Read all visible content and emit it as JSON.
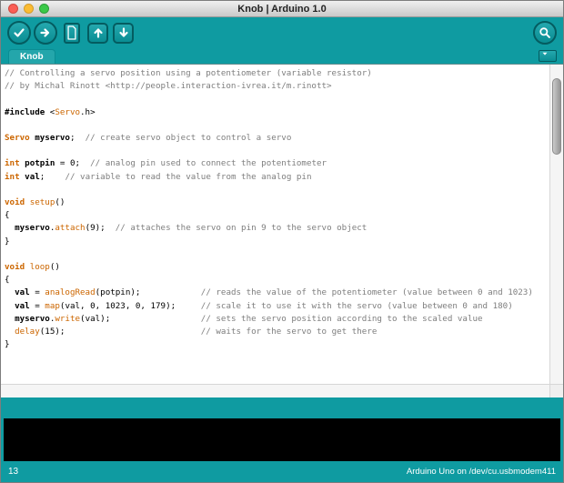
{
  "window": {
    "title": "Knob | Arduino 1.0"
  },
  "toolbar": {
    "left_buttons": [
      {
        "name": "verify",
        "icon": "check-icon",
        "shape": "circle"
      },
      {
        "name": "upload",
        "icon": "arrow-right-icon",
        "shape": "circle"
      },
      {
        "name": "new-sketch",
        "icon": "document-icon",
        "shape": "page"
      },
      {
        "name": "open",
        "icon": "arrow-up-icon",
        "shape": "square"
      },
      {
        "name": "save",
        "icon": "arrow-down-icon",
        "shape": "square"
      }
    ],
    "right_buttons": [
      {
        "name": "serial-monitor",
        "icon": "magnifier-icon",
        "shape": "circle"
      }
    ]
  },
  "tab_bar": {
    "tabs": [
      {
        "label": "Knob",
        "active": true
      }
    ],
    "menu_icon": "chevron-down-icon"
  },
  "editor": {
    "lines": [
      [
        [
          "c",
          "// Controlling a servo position using a potentiometer (variable resistor)"
        ]
      ],
      [
        [
          "c",
          "// by Michal Rinott <http://people.interaction-ivrea.it/m.rinott>"
        ]
      ],
      [],
      [
        [
          "b",
          "#include"
        ],
        [
          "p",
          " <"
        ],
        [
          "f",
          "Servo"
        ],
        [
          "p",
          ".h>"
        ]
      ],
      [],
      [
        [
          "k",
          "Servo"
        ],
        [
          "p",
          " "
        ],
        [
          "b",
          "myservo"
        ],
        [
          "p",
          ";  "
        ],
        [
          "c",
          "// create servo object to control a servo"
        ]
      ],
      [],
      [
        [
          "k",
          "int"
        ],
        [
          "p",
          " "
        ],
        [
          "b",
          "potpin"
        ],
        [
          "p",
          " = 0;  "
        ],
        [
          "c",
          "// analog pin used to connect the potentiometer"
        ]
      ],
      [
        [
          "k",
          "int"
        ],
        [
          "p",
          " "
        ],
        [
          "b",
          "val"
        ],
        [
          "p",
          ";    "
        ],
        [
          "c",
          "// variable to read the value from the analog pin"
        ]
      ],
      [],
      [
        [
          "k",
          "void"
        ],
        [
          "p",
          " "
        ],
        [
          "f",
          "setup"
        ],
        [
          "p",
          "()"
        ]
      ],
      [
        [
          "p",
          "{"
        ]
      ],
      [
        [
          "p",
          "  "
        ],
        [
          "b",
          "myservo"
        ],
        [
          "p",
          "."
        ],
        [
          "f",
          "attach"
        ],
        [
          "p",
          "(9);  "
        ],
        [
          "c",
          "// attaches the servo on pin 9 to the servo object"
        ]
      ],
      [
        [
          "p",
          "}"
        ]
      ],
      [],
      [
        [
          "k",
          "void"
        ],
        [
          "p",
          " "
        ],
        [
          "f",
          "loop"
        ],
        [
          "p",
          "()"
        ]
      ],
      [
        [
          "p",
          "{"
        ]
      ],
      [
        [
          "p",
          "  "
        ],
        [
          "b",
          "val"
        ],
        [
          "p",
          " = "
        ],
        [
          "f",
          "analogRead"
        ],
        [
          "p",
          "(potpin);            "
        ],
        [
          "c",
          "// reads the value of the potentiometer (value between 0 and 1023)"
        ]
      ],
      [
        [
          "p",
          "  "
        ],
        [
          "b",
          "val"
        ],
        [
          "p",
          " = "
        ],
        [
          "f",
          "map"
        ],
        [
          "p",
          "(val, 0, 1023, 0, 179);     "
        ],
        [
          "c",
          "// scale it to use it with the servo (value between 0 and 180)"
        ]
      ],
      [
        [
          "p",
          "  "
        ],
        [
          "b",
          "myservo"
        ],
        [
          "p",
          "."
        ],
        [
          "f",
          "write"
        ],
        [
          "p",
          "(val);                  "
        ],
        [
          "c",
          "// sets the servo position according to the scaled value"
        ]
      ],
      [
        [
          "p",
          "  "
        ],
        [
          "f",
          "delay"
        ],
        [
          "p",
          "(15);                           "
        ],
        [
          "c",
          "// waits for the servo to get there"
        ]
      ],
      [
        [
          "p",
          "}"
        ]
      ]
    ]
  },
  "status_bar": {
    "line_number": "13",
    "board_port": "Arduino Uno on /dev/cu.usbmodem411"
  },
  "colors": {
    "teal": "#0F9BA1",
    "teal_dark": "#045C60",
    "tab_active": "#24A6AB",
    "editor_bg": "#FFFFFF",
    "comment": "#7E7E7E",
    "keyword": "#CC6600",
    "console_bg": "#000000",
    "status_text": "#FFFFFF",
    "traffic_red": "#FA5E55",
    "traffic_yellow": "#FBBC33",
    "traffic_green": "#3AC948"
  }
}
